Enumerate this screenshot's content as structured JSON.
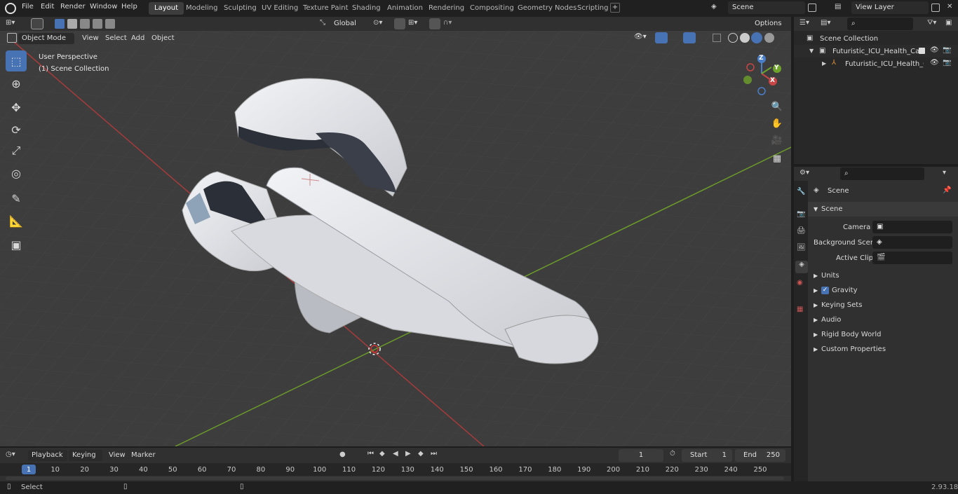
{
  "menu": [
    "File",
    "Edit",
    "Render",
    "Window",
    "Help"
  ],
  "workspaces": [
    "Layout",
    "Modeling",
    "Sculpting",
    "UV Editing",
    "Texture Paint",
    "Shading",
    "Animation",
    "Rendering",
    "Compositing",
    "Geometry Nodes",
    "Scripting"
  ],
  "active_workspace": "Layout",
  "scene_field": "Scene",
  "view_layer_field": "View Layer",
  "transform_orientation": "Global",
  "options_label": "Options",
  "viewport_header": {
    "mode": "Object Mode",
    "view": "View",
    "select": "Select",
    "add": "Add",
    "object": "Object"
  },
  "viewport_overlay_text": {
    "perspective": "User Perspective",
    "collection": "(1) Scene Collection"
  },
  "gizmo_axes": {
    "x": "X",
    "y": "Y",
    "z": "Z"
  },
  "outliner": {
    "root": "Scene Collection",
    "items": [
      {
        "label": "Futuristic_ICU_Health_Care_D"
      },
      {
        "label": "Futuristic_ICU_Health_Ca"
      }
    ]
  },
  "properties": {
    "context": "Scene",
    "panel": "Scene",
    "camera_label": "Camera",
    "background_scene_label": "Background Scene",
    "active_clip_label": "Active Clip",
    "sections": [
      "Units",
      "Gravity",
      "Keying Sets",
      "Audio",
      "Rigid Body World",
      "Custom Properties"
    ]
  },
  "timeline": {
    "playback": "Playback",
    "keying": "Keying",
    "view": "View",
    "marker": "Marker",
    "current_frame": "1",
    "start_label": "Start",
    "start": "1",
    "end_label": "End",
    "end": "250",
    "ticks": [
      "1",
      "10",
      "20",
      "30",
      "40",
      "50",
      "60",
      "70",
      "80",
      "90",
      "100",
      "110",
      "120",
      "130",
      "140",
      "150",
      "160",
      "170",
      "180",
      "190",
      "200",
      "210",
      "220",
      "230",
      "240",
      "250"
    ]
  },
  "status": {
    "select": "Select",
    "version": "2.93.18"
  },
  "colors": {
    "accent": "#4772b3",
    "viewport_bg": "#3d3d3d",
    "x_axis": "#a63b3b",
    "y_axis": "#6b9a2a"
  }
}
